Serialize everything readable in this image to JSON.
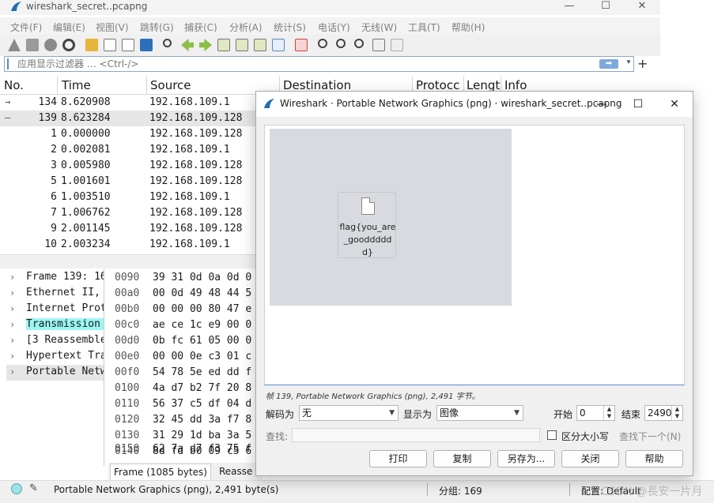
{
  "window": {
    "title": "wireshark_secret..pcapng",
    "controls": {
      "minimize": "—",
      "maximize": "☐",
      "close": "✕"
    }
  },
  "menu": [
    "文件(F)",
    "编辑(E)",
    "视图(V)",
    "跳转(G)",
    "捕获(C)",
    "分析(A)",
    "统计(S)",
    "电话(Y)",
    "无线(W)",
    "工具(T)",
    "帮助(H)"
  ],
  "filter": {
    "placeholder": "应用显示过滤器 … <Ctrl-/>",
    "apply_label": "➡",
    "add_label": "+"
  },
  "packet_list": {
    "columns": [
      "No.",
      "Time",
      "Source",
      "Destination",
      "Protocc",
      "Lengt",
      "Info"
    ],
    "rows": [
      {
        "no": "134",
        "time": "8.620908",
        "source": "192.168.109.1",
        "mark": "→"
      },
      {
        "no": "139",
        "time": "8.623284",
        "source": "192.168.109.128",
        "mark": "—",
        "selected": true
      },
      {
        "no": "1",
        "time": "0.000000",
        "source": "192.168.109.128"
      },
      {
        "no": "2",
        "time": "0.002081",
        "source": "192.168.109.1"
      },
      {
        "no": "3",
        "time": "0.005980",
        "source": "192.168.109.128"
      },
      {
        "no": "5",
        "time": "1.001601",
        "source": "192.168.109.128"
      },
      {
        "no": "6",
        "time": "1.003510",
        "source": "192.168.109.1"
      },
      {
        "no": "7",
        "time": "1.006762",
        "source": "192.168.109.128"
      },
      {
        "no": "9",
        "time": "2.001145",
        "source": "192.168.109.128"
      },
      {
        "no": "10",
        "time": "2.003234",
        "source": "192.168.109.1"
      }
    ]
  },
  "details": [
    {
      "text": "Frame 139: 16"
    },
    {
      "text": "Ethernet II,"
    },
    {
      "text": "Internet Prot"
    },
    {
      "text": "Transmission",
      "highlight": true
    },
    {
      "text": "[3 Reassemble"
    },
    {
      "text": "Hypertext Tra"
    },
    {
      "text": "Portable Netw"
    }
  ],
  "bytes": [
    {
      "offset": "0090",
      "hex": "39 31 0d 0a 0d 0"
    },
    {
      "offset": "00a0",
      "hex": "00 0d 49 48 44 5"
    },
    {
      "offset": "00b0",
      "hex": "00 00 00 80 47 e"
    },
    {
      "offset": "00c0",
      "hex": "ae ce 1c e9 00 0"
    },
    {
      "offset": "00d0",
      "hex": "0b fc 61 05 00 0"
    },
    {
      "offset": "00e0",
      "hex": "00 00 0e c3 01 c"
    },
    {
      "offset": "00f0",
      "hex": "54 78 5e ed dd f"
    },
    {
      "offset": "0100",
      "hex": "4a d7 b2 7f 20 8"
    },
    {
      "offset": "0110",
      "hex": "56 37 c5 df 04 d"
    },
    {
      "offset": "0120",
      "hex": "32 45 dd 3a f7 8"
    },
    {
      "offset": "0130",
      "hex": "31 29 1d ba 3a 5"
    },
    {
      "offset": "0140",
      "hex": "8d fd b0 09 c5 6"
    },
    {
      "offset": "0150",
      "hex": "62 7a d7 f3 75 f"
    }
  ],
  "byte_tabs": {
    "frame": "Frame (1085 bytes)",
    "reassembled": "Reasse"
  },
  "status": {
    "text": "Portable Network Graphics (png), 2,491 byte(s)",
    "group": "分组: 169",
    "profile": "配置: Default",
    "watermark": "CSDN @長安一片月"
  },
  "dialog": {
    "title": "Wireshark · Portable Network Graphics (png) · wireshark_secret..pcapng",
    "file_caption": "flag{you_are_goodddddd}",
    "frame_info": "帧 139, Portable Network Graphics (png), 2,491 字节。",
    "decode_label": "解码为",
    "decode_value": "无",
    "show_label": "显示为",
    "show_value": "图像",
    "start_label": "开始",
    "start_value": "0",
    "end_label": "结束",
    "end_value": "2490",
    "find_label": "查找:",
    "case_label": "区分大小写",
    "find_next_label": "查找下一个(N)",
    "buttons": {
      "print": "打印",
      "copy": "复制",
      "save_as": "另存为...",
      "close": "关闭",
      "help": "帮助"
    }
  },
  "colors": {
    "accent": "#0a64ad",
    "highlight": "#9bf5f2",
    "selection": "#e6e6e6",
    "status_led": "#9ee1e6"
  }
}
